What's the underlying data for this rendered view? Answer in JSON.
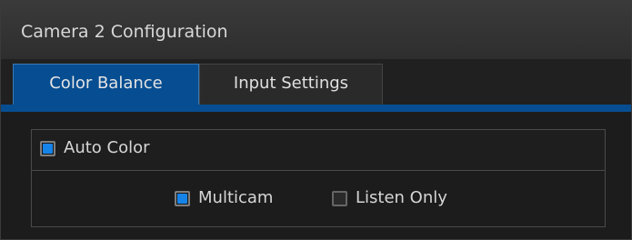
{
  "window": {
    "title": "Camera 2 Configuration"
  },
  "tabs": [
    {
      "label": "Color Balance",
      "active": true
    },
    {
      "label": "Input Settings",
      "active": false
    }
  ],
  "color_balance": {
    "auto_color": {
      "label": "Auto Color",
      "checked": true
    },
    "multicam": {
      "label": "Multicam",
      "checked": true
    },
    "listen_only": {
      "label": "Listen Only",
      "checked": false
    }
  },
  "colors": {
    "accent": "#074d91",
    "checkbox_fill": "#1683e8",
    "background": "#1c1c1c"
  }
}
